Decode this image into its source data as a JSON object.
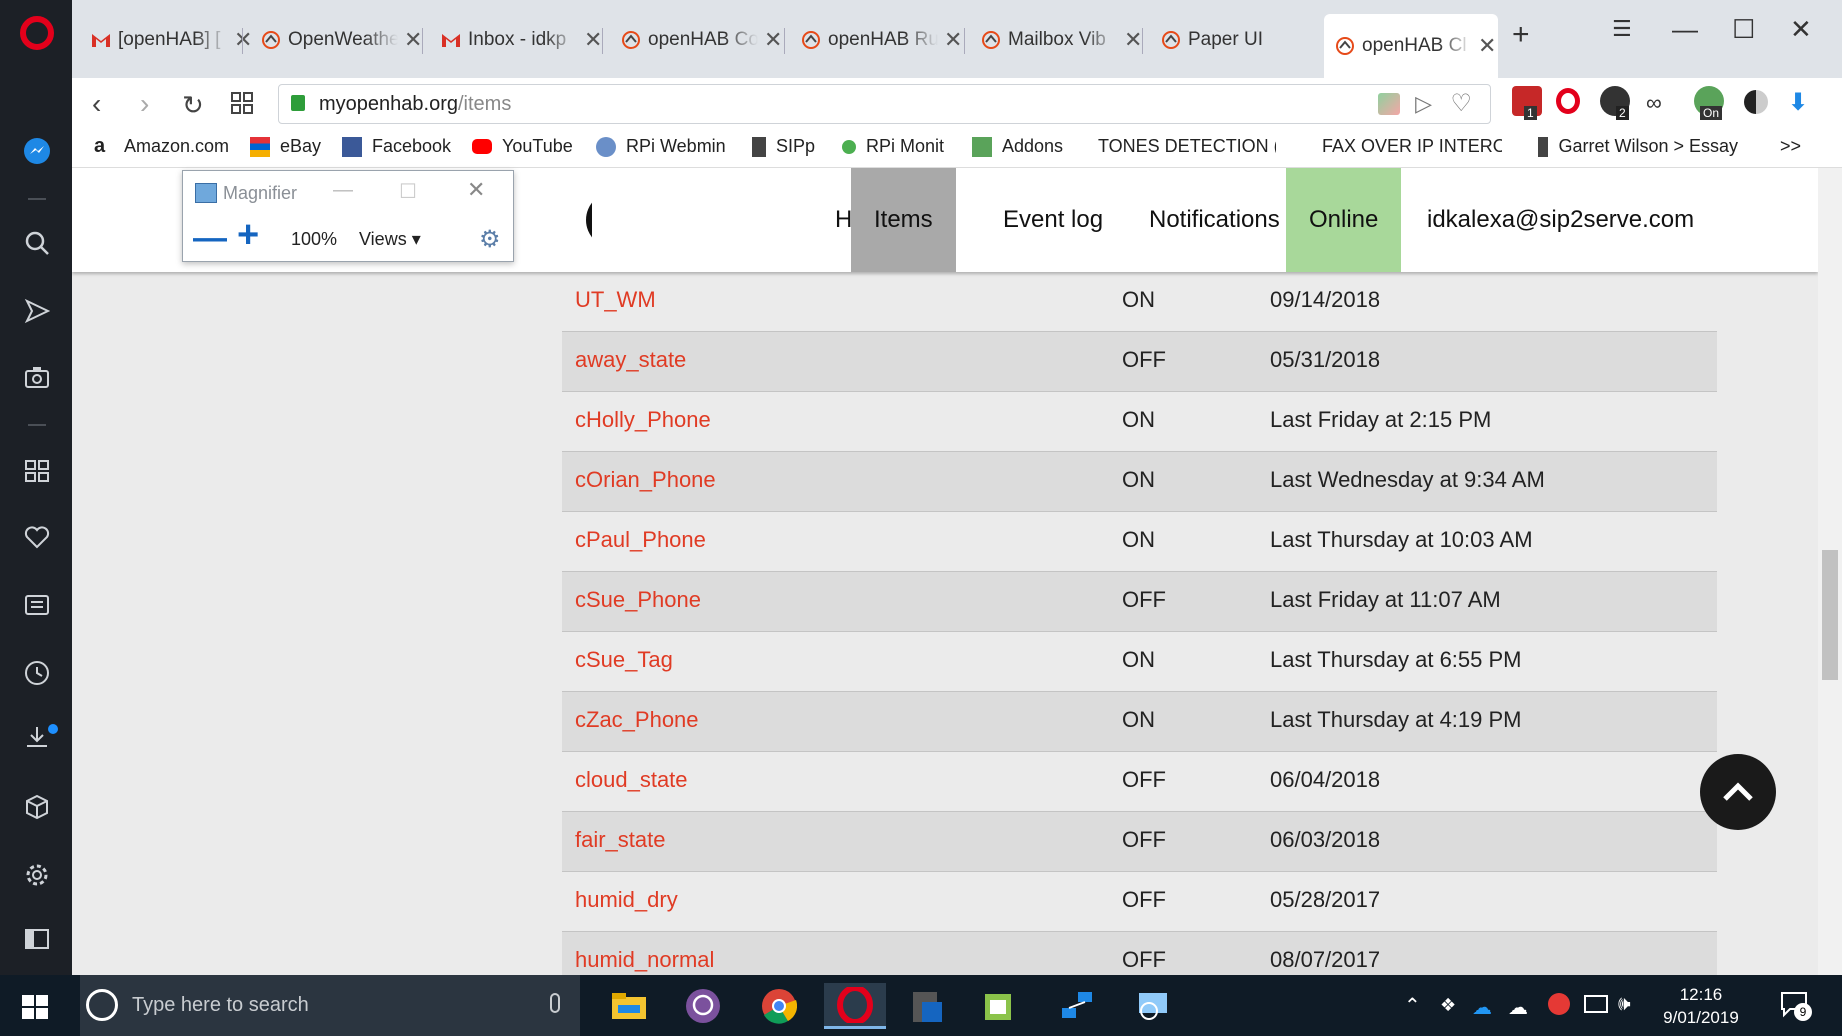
{
  "browser": {
    "tabs": [
      {
        "label": "[openHAB] [",
        "icon": "gmail-icon"
      },
      {
        "label": "OpenWeathe",
        "icon": "openhab-icon"
      },
      {
        "label": "Inbox - idkp",
        "icon": "gmail-icon"
      },
      {
        "label": "openHAB Co",
        "icon": "openhab-icon"
      },
      {
        "label": "openHAB Ru",
        "icon": "openhab-icon"
      },
      {
        "label": "Mailbox Vib",
        "icon": "openhab-icon"
      },
      {
        "label": "Paper UI",
        "icon": "openhab-icon"
      },
      {
        "label": "openHAB Cl",
        "icon": "openhab-icon",
        "active": true
      }
    ],
    "url_host": "myopenhab.org",
    "url_path": "/items",
    "bookmarks": [
      "Amazon.com",
      "eBay",
      "Facebook",
      "YouTube",
      "RPi Webmin",
      "SIPp",
      "RPi Monit",
      "Addons",
      "TONES DETECTION (\\",
      "FAX OVER IP INTEROI",
      "Garret Wilson > Essay"
    ],
    "bookmarks_more": ">>",
    "extension_badges": [
      "1",
      "2",
      "On"
    ]
  },
  "magnifier": {
    "title": "Magnifier",
    "zoom": "100%",
    "views_label": "Views"
  },
  "header": {
    "nav": [
      "Home",
      "Items",
      "Event log",
      "Notifications",
      "Online",
      "idkalexa@sip2serve.com"
    ]
  },
  "items": [
    {
      "name": "UT_WM",
      "state": "ON",
      "date": "09/14/2018"
    },
    {
      "name": "away_state",
      "state": "OFF",
      "date": "05/31/2018"
    },
    {
      "name": "cHolly_Phone",
      "state": "ON",
      "date": "Last Friday at 2:15 PM"
    },
    {
      "name": "cOrian_Phone",
      "state": "ON",
      "date": "Last Wednesday at 9:34 AM"
    },
    {
      "name": "cPaul_Phone",
      "state": "ON",
      "date": "Last Thursday at 10:03 AM"
    },
    {
      "name": "cSue_Phone",
      "state": "OFF",
      "date": "Last Friday at 11:07 AM"
    },
    {
      "name": "cSue_Tag",
      "state": "ON",
      "date": "Last Thursday at 6:55 PM"
    },
    {
      "name": "cZac_Phone",
      "state": "ON",
      "date": "Last Thursday at 4:19 PM"
    },
    {
      "name": "cloud_state",
      "state": "OFF",
      "date": "06/04/2018"
    },
    {
      "name": "fair_state",
      "state": "OFF",
      "date": "06/03/2018"
    },
    {
      "name": "humid_dry",
      "state": "OFF",
      "date": "05/28/2017"
    },
    {
      "name": "humid_normal",
      "state": "OFF",
      "date": "08/07/2017"
    }
  ],
  "taskbar": {
    "search_placeholder": "Type here to search",
    "time": "12:16",
    "date": "9/01/2019",
    "notification_count": "9"
  },
  "colors": {
    "item_name": "#e03b24",
    "items_tab": "#a9a9a9",
    "online_tab": "#a8d89a",
    "opera_red": "#e3001b"
  }
}
